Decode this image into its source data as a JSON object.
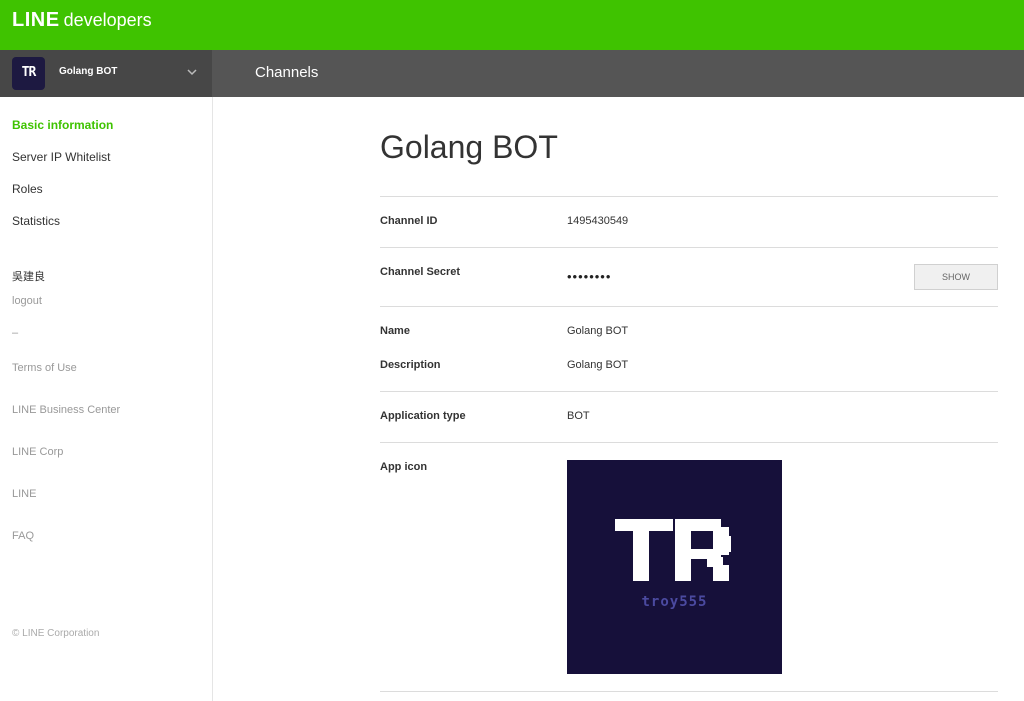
{
  "header": {
    "brand": "LINE",
    "sub": "developers"
  },
  "subheader": {
    "avatar_text": "TR",
    "channel_name": "Golang BOT",
    "section": "Channels"
  },
  "sidebar": {
    "nav": [
      {
        "label": "Basic information",
        "active": true
      },
      {
        "label": "Server IP Whitelist",
        "active": false
      },
      {
        "label": "Roles",
        "active": false
      },
      {
        "label": "Statistics",
        "active": false
      }
    ],
    "user_name": "吳建良",
    "logout": "logout",
    "separator": "–",
    "links": [
      "Terms of Use",
      "LINE Business Center",
      "LINE Corp",
      "LINE",
      "FAQ"
    ],
    "copyright": "© LINE Corporation"
  },
  "main": {
    "title": "Golang BOT",
    "channel_id_label": "Channel ID",
    "channel_id": "1495430549",
    "channel_secret_label": "Channel Secret",
    "channel_secret_masked": "••••••••",
    "show_button": "SHOW",
    "name_label": "Name",
    "name": "Golang BOT",
    "description_label": "Description",
    "description": "Golang BOT",
    "app_type_label": "Application type",
    "app_type": "BOT",
    "app_icon_label": "App icon",
    "app_icon_caption": "troy555"
  },
  "colors": {
    "brand_green": "#3fc300",
    "subbar": "#555555",
    "icon_bg": "#16103a"
  }
}
